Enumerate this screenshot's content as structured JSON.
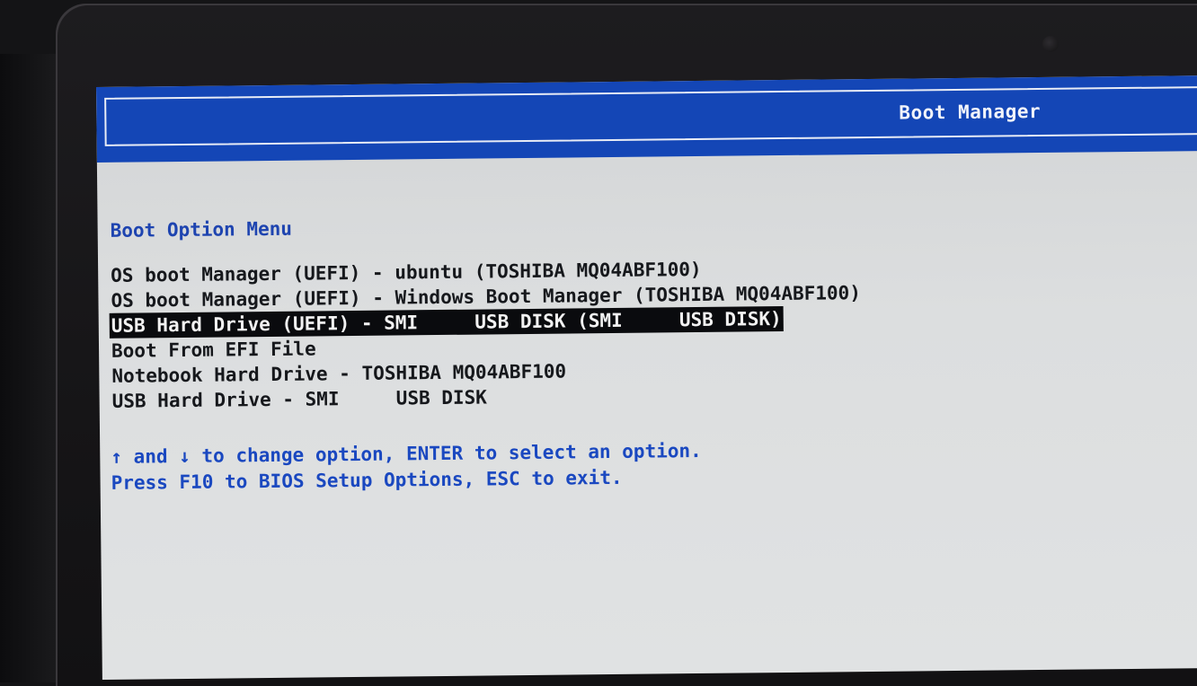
{
  "header": {
    "title": "Boot Manager"
  },
  "menu": {
    "title": "Boot Option Menu",
    "selected_index": 2,
    "options": [
      "OS boot Manager (UEFI) - ubuntu (TOSHIBA MQ04ABF100)",
      "OS boot Manager (UEFI) - Windows Boot Manager (TOSHIBA MQ04ABF100)",
      "USB Hard Drive (UEFI) - SMI     USB DISK (SMI     USB DISK)",
      "Boot From EFI File",
      "Notebook Hard Drive - TOSHIBA MQ04ABF100",
      "USB Hard Drive - SMI     USB DISK"
    ]
  },
  "help": {
    "line1": "↑ and ↓ to change option, ENTER to select an option.",
    "line2": "Press F10 to BIOS Setup Options, ESC to exit."
  },
  "colors": {
    "header_blue": "#1446b6",
    "screen_background": "#dcdedf",
    "help_text_blue": "#1a48c0",
    "selection_background": "#0a0b0e"
  }
}
